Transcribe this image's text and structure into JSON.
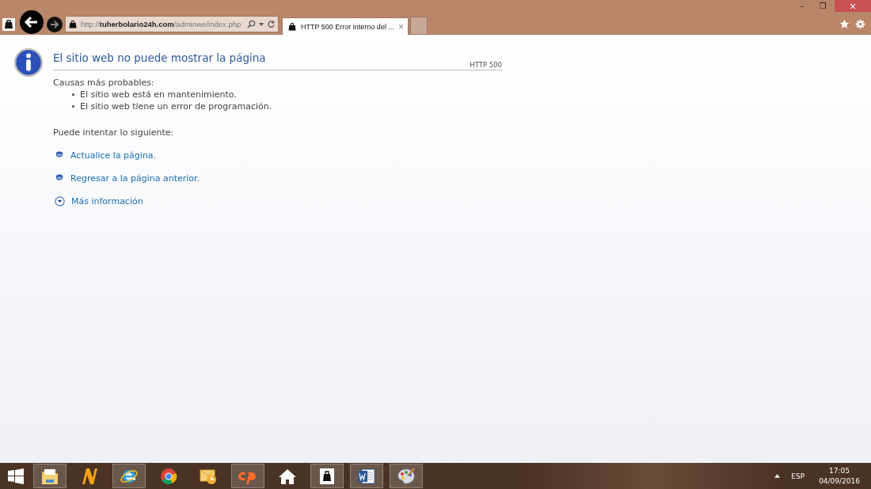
{
  "window": {
    "controls": [
      "–",
      "❐",
      "×"
    ]
  },
  "address_bar": {
    "url": "http://**tuherbolario24h.com**/adminwe/index.php"
  },
  "tabs": [
    {
      "label": "HTTP 500 Error interno del ...",
      "selected": true,
      "close": "×"
    }
  ],
  "page": {
    "title": "El sitio web no puede mostrar la página",
    "code": "HTTP 500",
    "causes_heading": "Causas más probables:",
    "causes": [
      "El sitio web está en mantenimiento.",
      "El sitio web tiene un error de programación."
    ],
    "try_heading": "Puede intentar lo siguiente:",
    "actions": [
      {
        "kind": "bullet",
        "label": "Actualice la página."
      },
      {
        "kind": "bullet",
        "label": "Regresar a la página anterior."
      },
      {
        "kind": "expander",
        "label": "Más información",
        "expanded": false
      }
    ]
  },
  "taskbar": {
    "apps": [
      {
        "kind": "folder",
        "running": true
      },
      {
        "kind": "letter-n",
        "running": false
      },
      {
        "kind": "browser-e",
        "running": true
      },
      {
        "kind": "chrome",
        "running": false
      },
      {
        "kind": "mail-clock",
        "running": false
      },
      {
        "kind": "cpanel",
        "running": true
      },
      {
        "kind": "home",
        "running": false
      },
      {
        "kind": "bag",
        "running": true
      },
      {
        "kind": "word",
        "running": true
      },
      {
        "kind": "palette",
        "running": true
      }
    ],
    "language": "ESP",
    "time": "17:05",
    "date": "04/09/2016"
  }
}
